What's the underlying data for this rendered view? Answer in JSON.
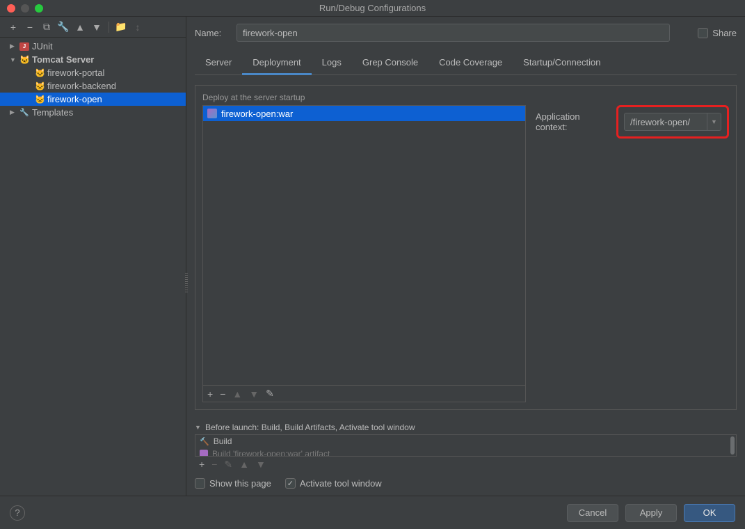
{
  "window": {
    "title": "Run/Debug Configurations"
  },
  "tree": {
    "junit": "JUnit",
    "tomcat": "Tomcat Server",
    "portal": "firework-portal",
    "backend": "firework-backend",
    "open": "firework-open",
    "templates": "Templates"
  },
  "form": {
    "name_label": "Name:",
    "name_value": "firework-open",
    "share_label": "Share"
  },
  "tabs": {
    "server": "Server",
    "deployment": "Deployment",
    "logs": "Logs",
    "grep": "Grep Console",
    "coverage": "Code Coverage",
    "startup": "Startup/Connection"
  },
  "deploy": {
    "label": "Deploy at the server startup",
    "artifact": "firework-open:war"
  },
  "context": {
    "label": "Application context:",
    "value": "/firework-open/"
  },
  "before_launch": {
    "title": "Before launch: Build, Build Artifacts, Activate tool window",
    "item1": "Build",
    "item2": "Build 'firework-open:war' artifact"
  },
  "checks": {
    "show_page": "Show this page",
    "activate": "Activate tool window"
  },
  "buttons": {
    "cancel": "Cancel",
    "apply": "Apply",
    "ok": "OK"
  }
}
